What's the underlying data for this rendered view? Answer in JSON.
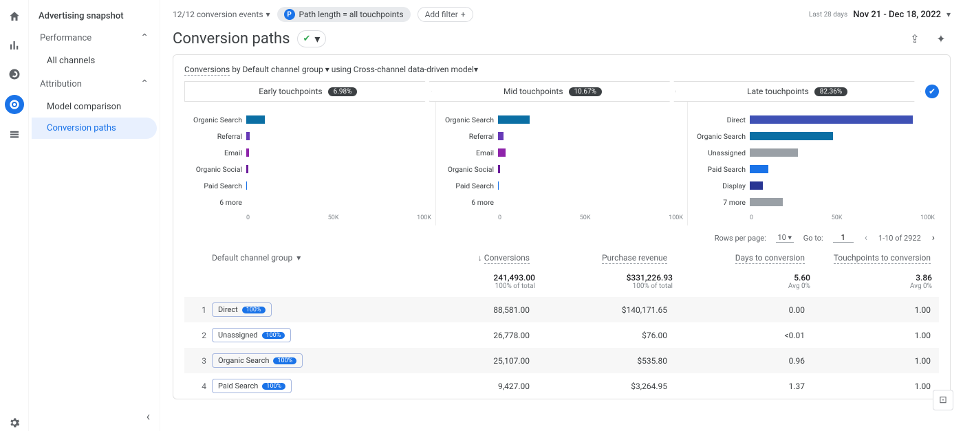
{
  "rail": {},
  "sidebar": {
    "title": "Advertising snapshot",
    "performance_label": "Performance",
    "all_channels": "All channels",
    "attribution_label": "Attribution",
    "model_comparison": "Model comparison",
    "conversion_paths": "Conversion paths"
  },
  "filters": {
    "events": "12/12 conversion events",
    "pathpill_p": "P",
    "pathpill": "Path length = all touchpoints",
    "add_filter": "Add filter",
    "date_small": "Last 28 days",
    "date": "Nov 21 - Dec 18, 2022"
  },
  "title": "Conversion paths",
  "crumb": {
    "a": "Conversions",
    "b": " by Default channel group",
    "c": "  using Cross-channel data-driven model"
  },
  "stages": {
    "early": "Early touchpoints",
    "early_pct": "6.98%",
    "mid": "Mid touchpoints",
    "mid_pct": "10.67%",
    "late": "Late touchpoints",
    "late_pct": "82.36%"
  },
  "axis_ticks": [
    "0",
    "50K",
    "100K"
  ],
  "chart_data": [
    {
      "type": "bar",
      "title": "Early touchpoints",
      "xlim": [
        0,
        100000
      ],
      "categories": [
        "Organic Search",
        "Referral",
        "Email",
        "Organic Social",
        "Paid Search",
        "6 more"
      ],
      "values": [
        10000,
        1800,
        1500,
        1000,
        500,
        0
      ],
      "colors": [
        "#0b6fa4",
        "#673ab7",
        "#8e24aa",
        "#6a1b9a",
        "#1a73e8",
        "#9aa0a6"
      ]
    },
    {
      "type": "bar",
      "title": "Mid touchpoints",
      "xlim": [
        0,
        100000
      ],
      "categories": [
        "Organic Search",
        "Referral",
        "Email",
        "Organic Social",
        "Paid Search",
        "6 more"
      ],
      "values": [
        17000,
        2800,
        4200,
        1100,
        300,
        0
      ],
      "colors": [
        "#0b6fa4",
        "#673ab7",
        "#8e24aa",
        "#6a1b9a",
        "#1a73e8",
        "#9aa0a6"
      ]
    },
    {
      "type": "bar",
      "title": "Late touchpoints",
      "xlim": [
        0,
        100000
      ],
      "categories": [
        "Direct",
        "Organic Search",
        "Unassigned",
        "Paid Search",
        "Display",
        "7 more"
      ],
      "values": [
        88000,
        45000,
        26000,
        10000,
        7000,
        18000
      ],
      "colors": [
        "#3f51b5",
        "#0b6fa4",
        "#9aa0a6",
        "#1a73e8",
        "#283593",
        "#9aa0a6"
      ]
    }
  ],
  "tablectrl": {
    "rpp_label": "Rows per page:",
    "rpp_value": "10",
    "goto_label": "Go to:",
    "goto_value": "1",
    "range": "1-10 of 2922"
  },
  "thead": {
    "grp": "Default channel group",
    "conv": "Conversions",
    "rev": "Purchase revenue",
    "days": "Days to conversion",
    "tp": "Touchpoints to conversion"
  },
  "totals": {
    "conv": "241,493.00",
    "conv_sub": "100% of total",
    "rev": "$331,226.93",
    "rev_sub": "100% of total",
    "days": "5.60",
    "days_sub": "Avg 0%",
    "tp": "3.86",
    "tp_sub": "Avg 0%"
  },
  "rows": [
    {
      "idx": "1",
      "name": "Direct",
      "badge": "100%",
      "conv": "88,581.00",
      "rev": "$140,171.65",
      "days": "0.00",
      "tp": "1.00"
    },
    {
      "idx": "2",
      "name": "Unassigned",
      "badge": "100%",
      "conv": "26,778.00",
      "rev": "$76.00",
      "days": "<0.01",
      "tp": "1.00"
    },
    {
      "idx": "3",
      "name": "Organic Search",
      "badge": "100%",
      "conv": "25,107.00",
      "rev": "$535.80",
      "days": "0.96",
      "tp": "1.00"
    },
    {
      "idx": "4",
      "name": "Paid Search",
      "badge": "100%",
      "conv": "9,427.00",
      "rev": "$3,264.95",
      "days": "1.37",
      "tp": "1.00"
    }
  ]
}
